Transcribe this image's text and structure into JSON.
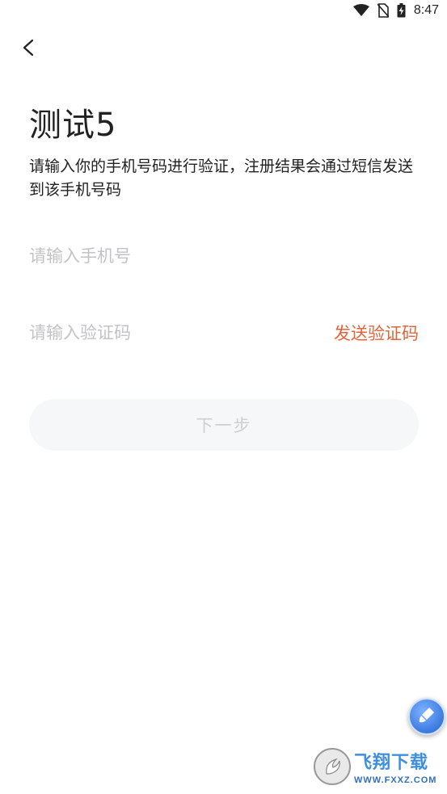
{
  "status_bar": {
    "time": "8:47",
    "icons": [
      "wifi-icon",
      "no-sim-icon",
      "battery-charging-icon"
    ]
  },
  "header": {
    "back_icon": "chevron-left-icon"
  },
  "page": {
    "title": "测试5",
    "description": "请输入你的手机号码进行验证，注册结果会通过短信发送到该手机号码"
  },
  "form": {
    "phone_placeholder": "请输入手机号",
    "phone_value": "",
    "code_placeholder": "请输入验证码",
    "code_value": "",
    "send_code_label": "发送验证码",
    "next_label": "下一步"
  },
  "floating_button": {
    "icon": "brush-icon"
  },
  "watermark": {
    "title": "飞翔下载",
    "url": "WWW.FXXZ.COM"
  },
  "colors": {
    "accent": "#e3643a",
    "placeholder": "#c3c3c7",
    "button_disabled_bg": "#f6f7f9",
    "button_disabled_text": "#cfcfd3"
  }
}
